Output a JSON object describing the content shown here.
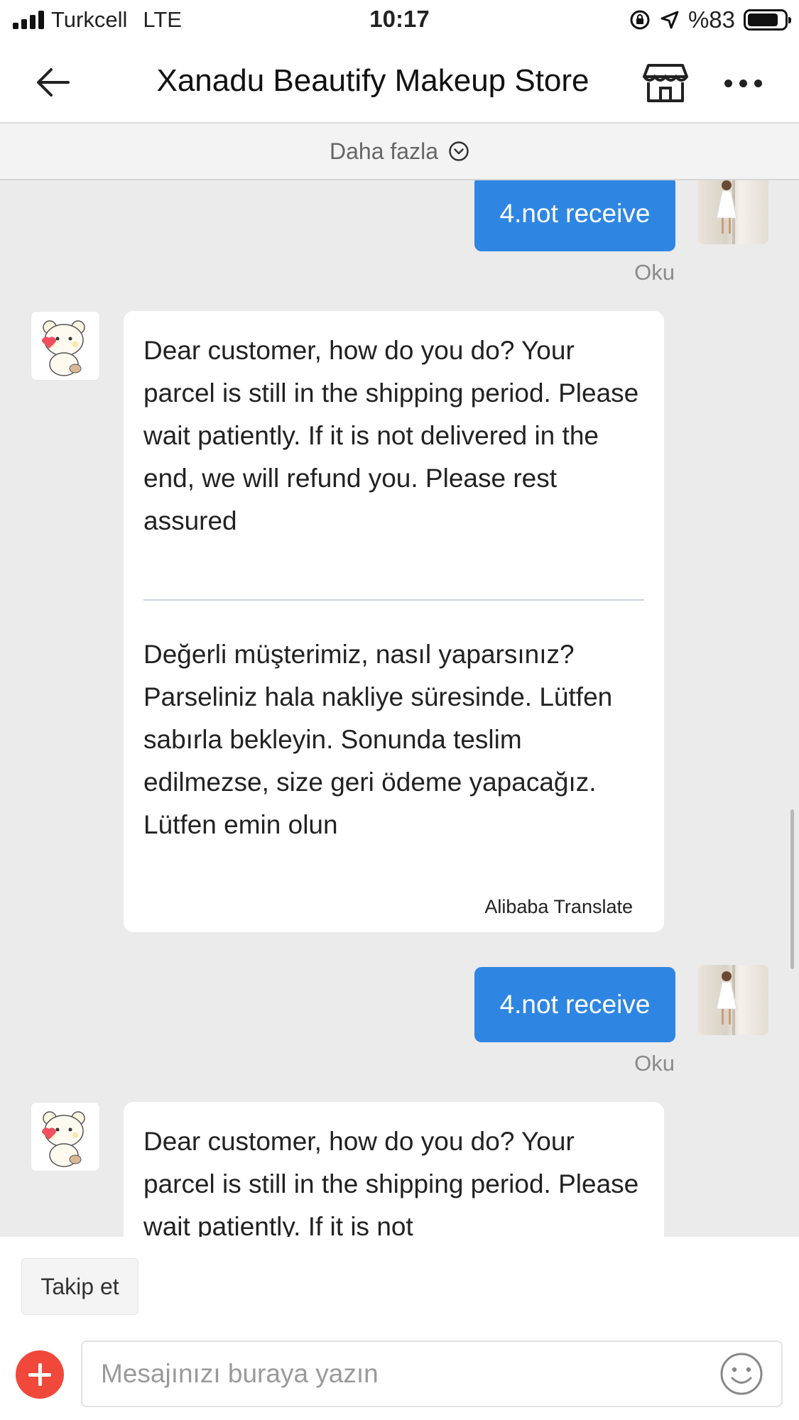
{
  "status_bar": {
    "carrier": "Turkcell",
    "network": "LTE",
    "time": "10:17",
    "battery": "%83",
    "battery_level": 0.83
  },
  "header": {
    "title": "Xanadu Beautify Makeup Store"
  },
  "more_bar": {
    "label": "Daha fazla"
  },
  "messages": [
    {
      "type": "outgoing",
      "text": "4.not receive",
      "status": "Oku"
    },
    {
      "type": "incoming",
      "text": "Dear customer, how do you do? Your parcel is still in the shipping period. Please wait patiently. If it is not delivered in the end, we will refund you. Please rest assured",
      "translation": "Değerli müşterimiz, nasıl yaparsınız? Parseliniz hala nakliye süresinde. Lütfen sabırla bekleyin. Sonunda teslim edilmezse, size geri ödeme yapacağız. Lütfen emin olun",
      "translator": "Alibaba Translate"
    },
    {
      "type": "outgoing",
      "text": "4.not receive",
      "status": "Oku"
    },
    {
      "type": "incoming",
      "text": "Dear customer, how do you do? Your parcel is still in the shipping period. Please wait patiently. If it is not"
    }
  ],
  "footer": {
    "follow_label": "Takip et",
    "input_placeholder": "Mesajınızı buraya yazın"
  },
  "colors": {
    "accent": "#2f86e2",
    "plus": "#f0483a",
    "background": "#ebebeb"
  }
}
